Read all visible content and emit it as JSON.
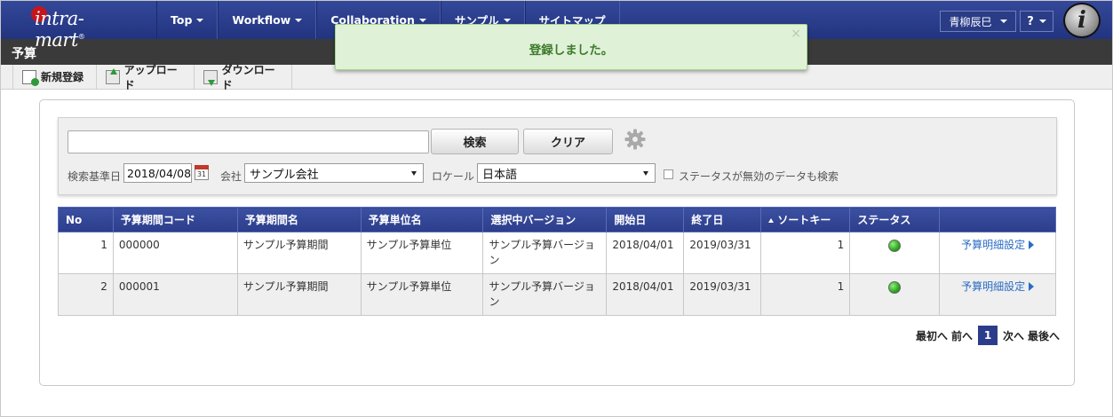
{
  "brand": {
    "name": "intra-mart",
    "reg": "®"
  },
  "nav": {
    "items": [
      {
        "label": "Top",
        "caret": true
      },
      {
        "label": "Workflow",
        "caret": true
      },
      {
        "label": "Collaboration",
        "caret": true
      },
      {
        "label": "サンプル",
        "caret": true
      },
      {
        "label": "サイトマップ",
        "caret": false
      }
    ],
    "user": "青柳辰巳",
    "help": "?",
    "i_logo": "i"
  },
  "page": {
    "title": "予算"
  },
  "toolbar": {
    "new_label": "新規登録",
    "upload_label": "アップロード",
    "download_label": "ダウンロード"
  },
  "toast": {
    "message": "登録しました。",
    "close": "×"
  },
  "search": {
    "keyword_value": "",
    "search_button": "検索",
    "clear_button": "クリア",
    "base_date_label": "検索基準日",
    "base_date_value": "2018/04/08",
    "calendar_day": "31",
    "company_label": "会社",
    "company_value": "サンプル会社",
    "locale_label": "ロケール",
    "locale_value": "日本語",
    "inactive_label": "ステータスが無効のデータも検索"
  },
  "table": {
    "headers": {
      "no": "No",
      "period_code": "予算期間コード",
      "period_name": "予算期間名",
      "unit_name": "予算単位名",
      "version": "選択中バージョン",
      "start": "開始日",
      "end": "終了日",
      "sort_key": "ソートキー",
      "status": "ステータス"
    },
    "rows": [
      {
        "no": "1",
        "period_code": "000000",
        "period_name": "サンプル予算期間",
        "unit_name": "サンプル予算単位",
        "version": "サンプル予算バージョン",
        "start": "2018/04/01",
        "end": "2019/03/31",
        "sort_key": "1",
        "status": "active",
        "action": "予算明細設定"
      },
      {
        "no": "2",
        "period_code": "000001",
        "period_name": "サンプル予算期間",
        "unit_name": "サンプル予算単位",
        "version": "サンプル予算バージョン",
        "start": "2018/04/01",
        "end": "2019/03/31",
        "sort_key": "1",
        "status": "active",
        "action": "予算明細設定"
      }
    ]
  },
  "pager": {
    "first": "最初へ",
    "prev": "前へ",
    "current": "1",
    "next": "次へ",
    "last": "最後へ"
  },
  "colors": {
    "nav": "#22347f",
    "status_active": "#2fa51f",
    "toast_bg": "#dff2d8",
    "link": "#2b6cc4"
  }
}
